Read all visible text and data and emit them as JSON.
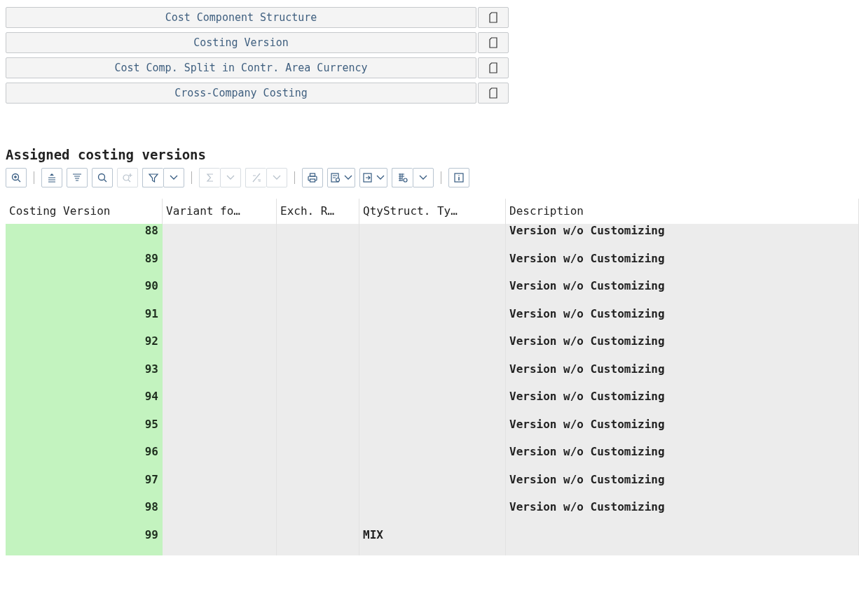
{
  "buttons": [
    {
      "label": "Cost Component Structure"
    },
    {
      "label": "Costing Version"
    },
    {
      "label": "Cost Comp. Split in Contr. Area Currency"
    },
    {
      "label": "Cross-Company Costing"
    }
  ],
  "section_title": "Assigned costing versions",
  "toolbar": [
    {
      "kind": "button",
      "disabled": false
    },
    {
      "kind": "separator"
    },
    {
      "kind": "button",
      "disabled": false
    },
    {
      "kind": "button",
      "disabled": false
    },
    {
      "kind": "button",
      "disabled": false
    },
    {
      "kind": "button",
      "disabled": true
    },
    {
      "kind": "split",
      "disabled": false
    },
    {
      "kind": "separator"
    },
    {
      "kind": "split",
      "disabled": true
    },
    {
      "kind": "split",
      "disabled": true
    },
    {
      "kind": "separator"
    },
    {
      "kind": "button",
      "disabled": false
    },
    {
      "kind": "menu",
      "disabled": false
    },
    {
      "kind": "menu",
      "disabled": false
    },
    {
      "kind": "split",
      "disabled": false
    },
    {
      "kind": "separator"
    },
    {
      "kind": "button",
      "disabled": false
    }
  ],
  "table": {
    "columns": [
      "Costing Version",
      "Variant fo…",
      "Exch. R…",
      "QtyStruct. Ty…",
      "Description"
    ],
    "rows": [
      {
        "costing_version": "88",
        "description": "Version w/o Customizing"
      },
      {
        "costing_version": "89",
        "description": "Version w/o Customizing"
      },
      {
        "costing_version": "90",
        "description": "Version w/o Customizing"
      },
      {
        "costing_version": "91",
        "description": "Version w/o Customizing"
      },
      {
        "costing_version": "92",
        "description": "Version w/o Customizing"
      },
      {
        "costing_version": "93",
        "description": "Version w/o Customizing"
      },
      {
        "costing_version": "94",
        "description": "Version w/o Customizing"
      },
      {
        "costing_version": "95",
        "description": "Version w/o Customizing"
      },
      {
        "costing_version": "96",
        "description": "Version w/o Customizing"
      },
      {
        "costing_version": "97",
        "description": "Version w/o Customizing"
      },
      {
        "costing_version": "98",
        "description": "Version w/o Customizing"
      },
      {
        "costing_version": "99",
        "qtystruct_type": "MIX"
      }
    ]
  }
}
